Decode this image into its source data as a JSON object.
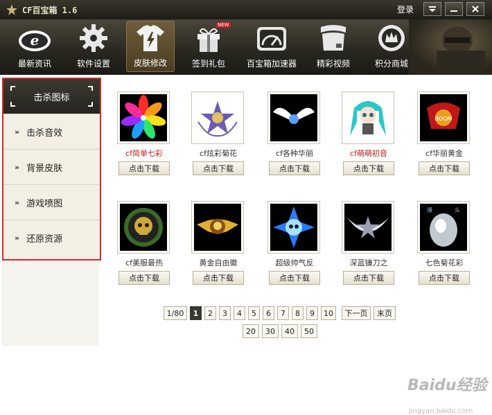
{
  "window": {
    "title": "CF百宝箱 1.6",
    "login_label": "登录",
    "menu_icon": "menu-down-icon",
    "min_icon": "minimize-icon",
    "close_icon": "close-icon"
  },
  "toolbar": {
    "items": [
      {
        "label": "最新资讯",
        "icon": "news-e-icon"
      },
      {
        "label": "软件设置",
        "icon": "gear-icon"
      },
      {
        "label": "皮肤修改",
        "icon": "tshirt-icon",
        "active": true
      },
      {
        "label": "签到礼包",
        "icon": "gift-icon",
        "badge": "NEW"
      },
      {
        "label": "百宝箱加速器",
        "icon": "speedometer-icon"
      },
      {
        "label": "精彩视频",
        "icon": "video-icon"
      },
      {
        "label": "积分商城",
        "icon": "shop-icon"
      }
    ]
  },
  "sidebar": {
    "items": [
      {
        "label": "击杀图标",
        "active": true
      },
      {
        "label": "击杀音效"
      },
      {
        "label": "背景皮肤"
      },
      {
        "label": "游戏喷图"
      },
      {
        "label": "还原资源"
      }
    ]
  },
  "grid": {
    "download_label": "点击下载",
    "items": [
      {
        "name": "cf简单七彩",
        "highlight": true,
        "colors": [
          "#ff2a6d",
          "#2ee66b"
        ]
      },
      {
        "name": "cf炫彩菊花",
        "highlight": false,
        "colors": [
          "#6b5bb5",
          "#d0c8f0"
        ]
      },
      {
        "name": "cf各种华丽",
        "highlight": false,
        "colors": [
          "#5aa0ff",
          "#ffffff"
        ]
      },
      {
        "name": "cf萌萌初音",
        "highlight": true,
        "colors": [
          "#28c8c8",
          "#ffffff"
        ]
      },
      {
        "name": "cf华丽黄金",
        "highlight": false,
        "colors": [
          "#e8a020",
          "#c01818"
        ]
      },
      {
        "name": "cf美服最热",
        "highlight": false,
        "colors": [
          "#d0a838",
          "#3a6a28"
        ]
      },
      {
        "name": "黄金自由徽",
        "highlight": false,
        "colors": [
          "#e0b030",
          "#8a5010"
        ]
      },
      {
        "name": "超级帅气反",
        "highlight": false,
        "colors": [
          "#2a7aff",
          "#a8e0ff"
        ]
      },
      {
        "name": "深蓝镰刀之",
        "highlight": false,
        "colors": [
          "#9aa0b0",
          "#e0e0e8"
        ]
      },
      {
        "name": "七色菊花彩",
        "highlight": false,
        "colors": [
          "#c0c8d0",
          "#ffffff"
        ]
      }
    ]
  },
  "pager": {
    "info": "1/80",
    "pages": [
      "1",
      "2",
      "3",
      "4",
      "5",
      "6",
      "7",
      "8",
      "9",
      "10"
    ],
    "current": "1",
    "next_label": "下一页",
    "last_label": "末页",
    "page_sizes": [
      "20",
      "30",
      "40",
      "50"
    ]
  },
  "watermark": {
    "text": "Baidu经验",
    "url": "jingyan.baidu.com"
  }
}
